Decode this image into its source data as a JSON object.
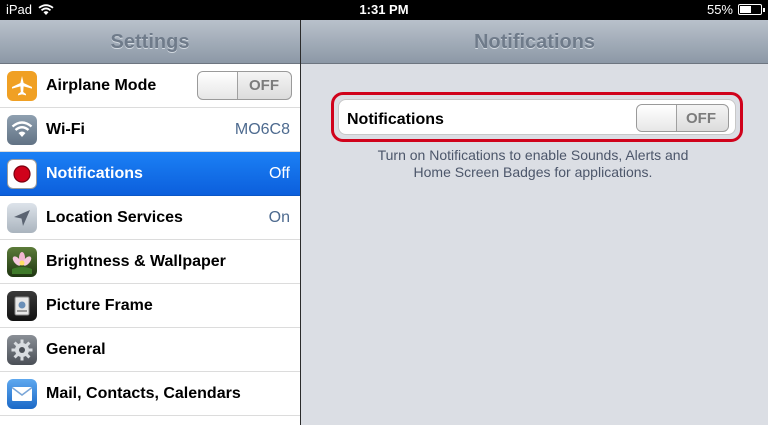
{
  "statusbar": {
    "device": "iPad",
    "time": "1:31 PM",
    "battery_percent": "55%",
    "battery_level": 0.55
  },
  "sidebar": {
    "title": "Settings",
    "items": [
      {
        "label": "Airplane Mode",
        "value": "",
        "toggle": "OFF",
        "icon": "airplane-icon"
      },
      {
        "label": "Wi-Fi",
        "value": "MO6C8",
        "icon": "wifi-icon"
      },
      {
        "label": "Notifications",
        "value": "Off",
        "icon": "notifications-icon",
        "selected": true
      },
      {
        "label": "Location Services",
        "value": "On",
        "icon": "location-icon"
      },
      {
        "label": "Brightness & Wallpaper",
        "value": "",
        "icon": "brightness-icon"
      },
      {
        "label": "Picture Frame",
        "value": "",
        "icon": "picture-frame-icon"
      },
      {
        "label": "General",
        "value": "",
        "icon": "gear-icon"
      },
      {
        "label": "Mail, Contacts, Calendars",
        "value": "",
        "icon": "mail-icon"
      }
    ]
  },
  "detail": {
    "title": "Notifications",
    "notifications_label": "Notifications",
    "notifications_toggle": "OFF",
    "footer_line1": "Turn on Notifications to enable Sounds, Alerts and",
    "footer_line2": "Home Screen Badges for applications."
  },
  "colors": {
    "selected_row": "#1b80f5",
    "highlight_border": "#d0021b",
    "value_text": "#4d6a8f"
  }
}
